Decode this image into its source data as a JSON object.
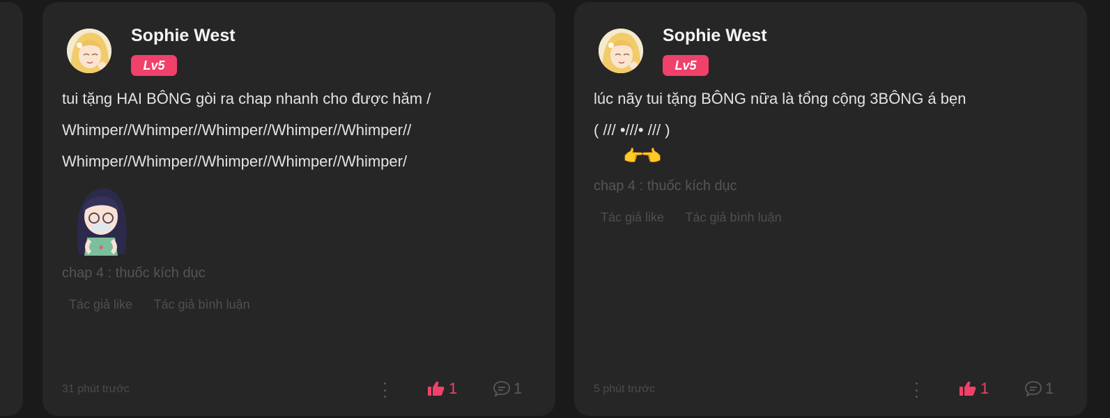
{
  "colors": {
    "page_bg": "#1a1a1a",
    "card_bg": "#262626",
    "accent": "#f0416b",
    "muted_text": "#555555"
  },
  "comments": [
    {
      "username": "Sophie West",
      "level": "Lv5",
      "lines": [
        "tui tặng HAI BÔNG gòi ra chap nhanh cho được hăm /",
        "Whimper//Whimper//Whimper//Whimper//Whimper//",
        "Whimper//Whimper//Whimper//Whimper//Whimper/"
      ],
      "chapter": "chap 4 : thuốc kích dục",
      "author_like": "Tác giả like",
      "author_reply": "Tác giả bình luận",
      "time": "31 phút trước",
      "likes": "1",
      "replies": "1"
    },
    {
      "username": "Sophie West",
      "level": "Lv5",
      "lines": [
        "lúc nãy tui tặng BÔNG nữa là tổng cộng 3BÔNG á bẹn",
        "( /// •///• /// )"
      ],
      "emoji": "👉👈",
      "chapter": "chap 4 : thuốc kích dục",
      "author_like": "Tác giả like",
      "author_reply": "Tác giả bình luận",
      "time": "5 phút trước",
      "likes": "1",
      "replies": "1"
    }
  ]
}
